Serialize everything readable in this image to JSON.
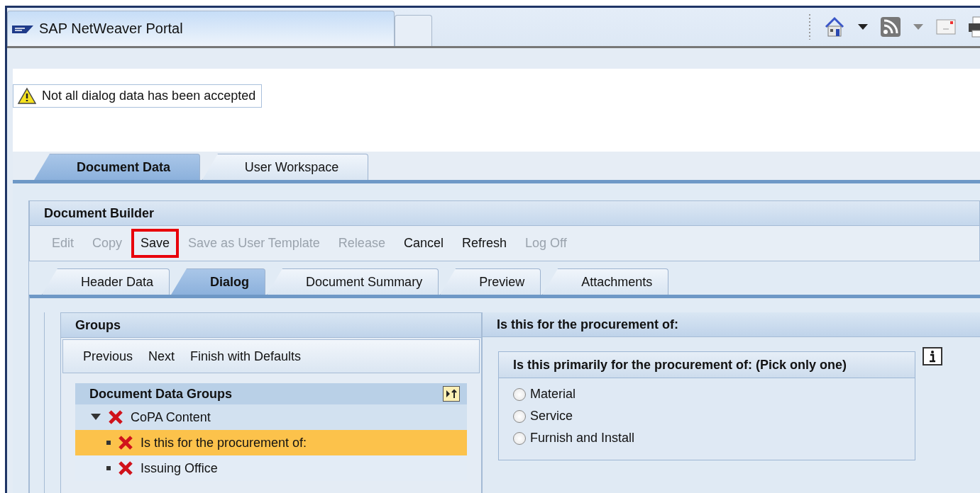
{
  "browser": {
    "tabs": [
      {
        "title": "SAP NetWeaver Portal",
        "selected": true
      },
      {
        "selected": false
      }
    ]
  },
  "message": {
    "text": "Not all dialog data has been accepted"
  },
  "main_tabs": [
    {
      "label": "Document Data",
      "selected": true
    },
    {
      "label": "User Workspace",
      "selected": false
    }
  ],
  "panel": {
    "title": "Document Builder",
    "actions": [
      {
        "label": "Edit",
        "disabled": true,
        "highlighted": false
      },
      {
        "label": "Copy",
        "disabled": true,
        "highlighted": false
      },
      {
        "label": "Save",
        "disabled": false,
        "highlighted": true
      },
      {
        "label": "Save as User Template",
        "disabled": true,
        "highlighted": false
      },
      {
        "label": "Release",
        "disabled": true,
        "highlighted": false
      },
      {
        "label": "Cancel",
        "disabled": false,
        "highlighted": false
      },
      {
        "label": "Refresh",
        "disabled": false,
        "highlighted": false
      },
      {
        "label": "Log Off",
        "disabled": true,
        "highlighted": false
      }
    ],
    "tabs": [
      {
        "label": "Header Data",
        "selected": false
      },
      {
        "label": "Dialog",
        "selected": true
      },
      {
        "label": "Document Summary",
        "selected": false
      },
      {
        "label": "Preview",
        "selected": false
      },
      {
        "label": "Attachments",
        "selected": false
      }
    ]
  },
  "groups": {
    "title": "Groups",
    "actions": [
      "Previous",
      "Next",
      "Finish with Defaults"
    ],
    "tree_title": "Document Data Groups",
    "tree": [
      {
        "label": "CoPA Content",
        "error": true,
        "expanded": true,
        "selected": false,
        "children": [
          {
            "label": "Is this for the procurement of:",
            "error": true,
            "selected": true
          },
          {
            "label": "Issuing Office",
            "error": true,
            "selected": false
          }
        ]
      }
    ]
  },
  "question": {
    "title": "Is this for the procurement of:",
    "group_title": "Is this primarily for the procurement of: (Pick only one)",
    "options": [
      {
        "label": "Material",
        "selected": false
      },
      {
        "label": "Service",
        "selected": false
      },
      {
        "label": "Furnish and Install",
        "selected": false
      }
    ]
  }
}
